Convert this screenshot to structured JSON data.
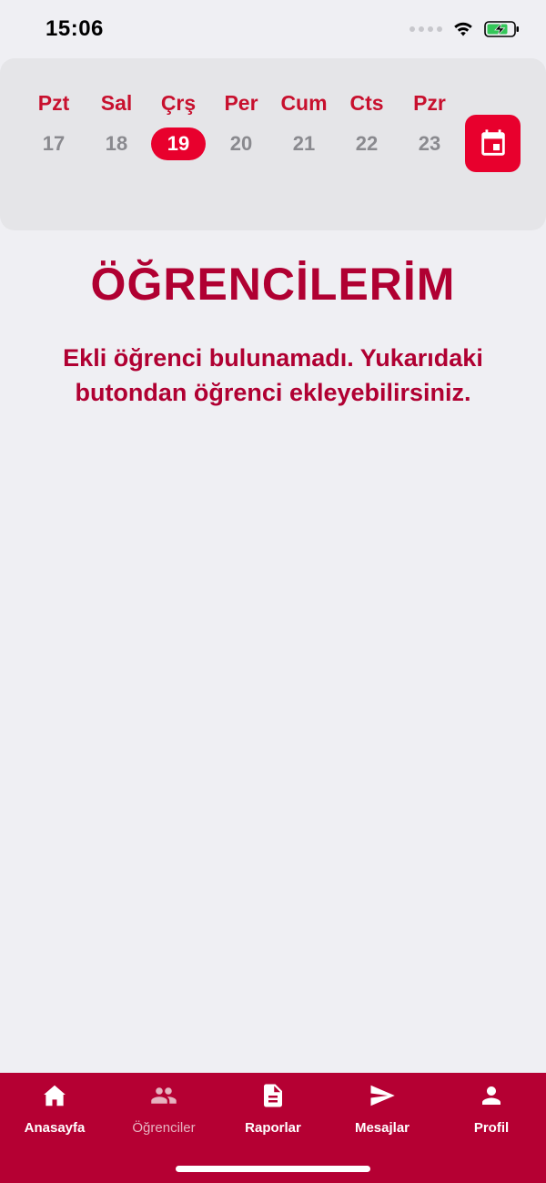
{
  "status_bar": {
    "time": "15:06"
  },
  "week": {
    "days": [
      {
        "name": "Pzt",
        "number": "17",
        "selected": false
      },
      {
        "name": "Sal",
        "number": "18",
        "selected": false
      },
      {
        "name": "Çrş",
        "number": "19",
        "selected": true
      },
      {
        "name": "Per",
        "number": "20",
        "selected": false
      },
      {
        "name": "Cum",
        "number": "21",
        "selected": false
      },
      {
        "name": "Cts",
        "number": "22",
        "selected": false
      },
      {
        "name": "Pzr",
        "number": "23",
        "selected": false
      }
    ],
    "calendar_icon": "calendar-icon"
  },
  "main": {
    "title": "ÖĞRENCİLERİM",
    "empty_message": "Ekli öğrenci bulunamadı. Yukarıdaki butondan öğrenci ekleyebilirsiniz."
  },
  "bottom_nav": {
    "items": [
      {
        "label": "Anasayfa",
        "icon": "home-icon",
        "active": true
      },
      {
        "label": "Öğrenciler",
        "icon": "users-icon",
        "active": false
      },
      {
        "label": "Raporlar",
        "icon": "document-icon",
        "active": true
      },
      {
        "label": "Mesajlar",
        "icon": "send-icon",
        "active": true
      },
      {
        "label": "Profil",
        "icon": "person-icon",
        "active": true
      }
    ]
  },
  "colors": {
    "accent": "#e8002d",
    "brand_dark": "#b50033",
    "background": "#efeff3"
  }
}
